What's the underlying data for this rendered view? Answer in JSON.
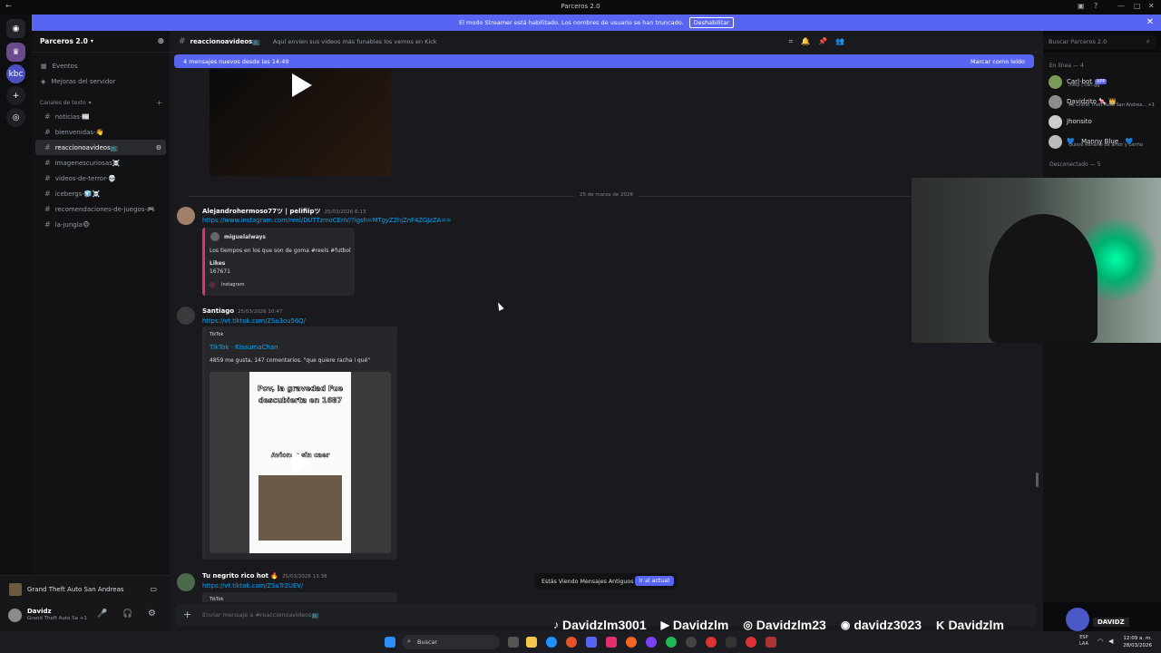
{
  "window": {
    "title": "Parceros 2.0"
  },
  "banner": {
    "text": "El modo Streamer está habilitado. Los nombres de usuario se han truncado.",
    "button": "Deshabilitar"
  },
  "sidebar": {
    "server": "Parceros 2.0",
    "items": [
      "Eventos",
      "Mejoras del servidor"
    ],
    "category": "Canales de texto",
    "channels": [
      "noticias-📰",
      "bienvenidas-👋",
      "reaccionoavideos📺",
      "imagenescuriosas☠️",
      "videos-de-terror-💀",
      "icebergs-🧊☠️",
      "recomendaciones-de-juegos-🎮",
      "la-jungla🐵"
    ],
    "voice_activity": "Grand Theft Auto San Andreas"
  },
  "user": {
    "name": "Davidz",
    "status": "Grand Theft Auto Sa +1"
  },
  "channel": {
    "name": "reaccionoavideos📺",
    "topic": "Aquí envíen sus videos más funables los vemos en Kick",
    "search_placeholder": "Buscar Parceros 2.0"
  },
  "new_messages": {
    "text": "4 mensajes nuevos desde las 14:49",
    "action": "Marcar como leído"
  },
  "date_divider": "25 de marzo de 2026",
  "messages": [
    {
      "author": "Alejandrohermoso77ツ | pelifiipツ",
      "time": "25/03/2026 6:13",
      "link": "https://www.instagram.com/reel/DUTTzmoCEnV/?igsh=MTgyZ2hjZnF4ZGJzZA==",
      "embed": {
        "user": "miguelalways",
        "desc": "Los tiempos en los que son de goma #reels #futbol",
        "likes_label": "Likes",
        "likes": "167671",
        "provider": "Instagram"
      }
    },
    {
      "author": "Santiago",
      "time": "25/03/2026 10:47",
      "link": "https://vt.tiktok.com/ZSu3ou56Q/",
      "embed": {
        "provider": "TikTok",
        "title": "TikTok · KissumaChan",
        "desc": "4859 me gusta, 147 comentarios. \"que quiere racha i qué\"",
        "caption": "Pov, la gravedad Fue descubierta en 1687",
        "caption2": "Aviones sin caer"
      }
    },
    {
      "author": "Tu negrito rico hot 🔥",
      "time": "25/03/2026 13:38",
      "link": "https://vt.tiktok.com/ZSuTr2UEV/",
      "embed": {
        "provider": "TikTok"
      }
    }
  ],
  "composer": {
    "placeholder": "Enviar mensaje a #reaccionoavideos📺"
  },
  "old_messages": {
    "text": "Estás Viendo Mensajes Antiguos",
    "button": "Ir al actual"
  },
  "members": {
    "online_header": "En línea — 4",
    "offline_header": "Desconectado — 5",
    "list": [
      {
        "name": "Carl-bot",
        "badge": "APP",
        "sub": "/help | carl.gg"
      },
      {
        "name": "Davidzito 🍬 👑",
        "sub": "🎮 Grand Theft Auto San Andrea... +1"
      },
      {
        "name": "Jhonsito",
        "sub": ""
      },
      {
        "name": "💙 ⠀Manny Blue ⠀💙",
        "sub": "Quiero Renarte de amor y cariño "
      }
    ]
  },
  "socials": {
    "tiktok": "Davidzlm3001",
    "youtube": "Davidzlm",
    "instagram": "Davidzlm23",
    "discord": "davidz3023",
    "kick": "Davidzlm",
    "logo_text": "DAVIDZ"
  },
  "taskbar": {
    "search": "Buscar",
    "lang1": "ESP",
    "lang2": "LAA",
    "time": "12:09 a. m.",
    "date": "28/03/2026"
  },
  "colors": {
    "accent": "#5865f2",
    "link": "#00a8fc",
    "bg": "#1a1a1e",
    "instagram": "#e1306c"
  }
}
